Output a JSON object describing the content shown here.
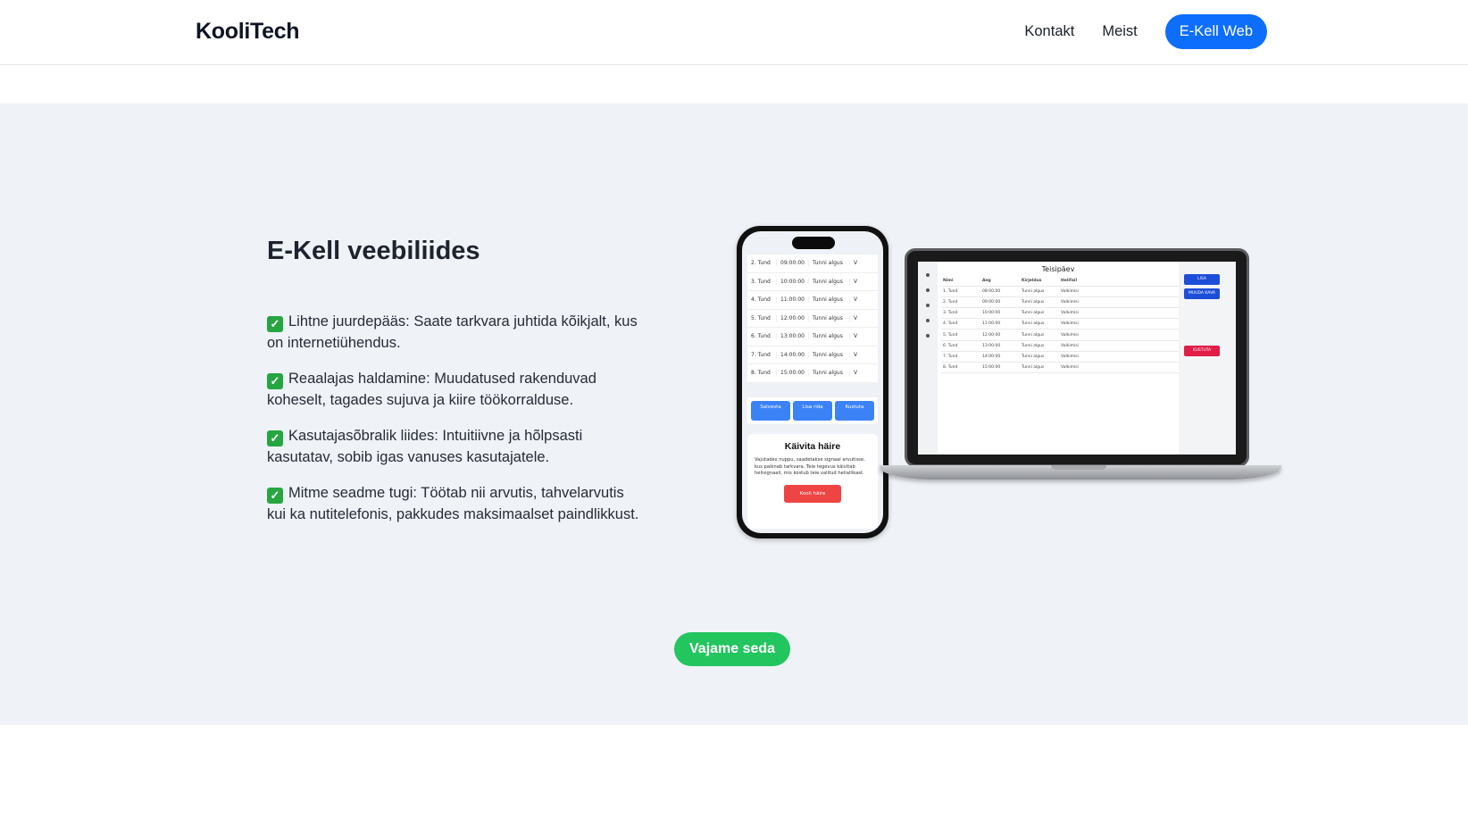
{
  "header": {
    "logo": "KooliTech",
    "nav": [
      "Kontakt",
      "Meist"
    ],
    "cta": "E-Kell Web"
  },
  "hero": {
    "title": "E-Kell veebiliides",
    "features": [
      "Lihtne juurdepääs: Saate tarkvara juhtida kõikjalt, kus on internetiühendus.",
      "Reaalajas haldamine: Muudatused rakenduvad koheselt, tagades sujuva ja kiire töökorralduse.",
      "Kasutajasõbralik liides: Intuitiivne ja hõlpsasti kasutatav, sobib igas vanuses kasutajatele.",
      "Mitme seadme tugi: Töötab nii arvutis, tahvelarvutis kui ka nutitelefonis, pakkudes maksimaalset paindlikkust."
    ],
    "check_icon": "✓",
    "button": "Vajame seda"
  },
  "phone": {
    "rows": [
      [
        "2. Tund",
        "09:00:00",
        "Tunni algus",
        "V"
      ],
      [
        "3. Tund",
        "10:00:00",
        "Tunni algus",
        "V"
      ],
      [
        "4. Tund",
        "11:00:00",
        "Tunni algus",
        "V"
      ],
      [
        "5. Tund",
        "12:00:00",
        "Tunni algus",
        "V"
      ],
      [
        "6. Tund",
        "13:00:00",
        "Tunni algus",
        "V"
      ],
      [
        "7. Tund",
        "14:00:00",
        "Tunni algus",
        "V"
      ],
      [
        "8. Tund",
        "15:00:00",
        "Tunni algus",
        "V"
      ]
    ],
    "buttons": [
      "Salvesta",
      "Lisa rida",
      "Kustuta"
    ],
    "card_title": "Käivita häire",
    "card_text": "Vajutades nuppu, saadetakse signaal arvutisse, kus paikneb tarkvara. Teie tegevus käivitab helisignaali, mis kostub teie valitud heliallikast.",
    "card_button": "Kooli häire"
  },
  "laptop": {
    "heading": "Teisipäev",
    "columns": [
      "Nimi",
      "Aeg",
      "Kirjeldus",
      "Helifail"
    ],
    "rows": [
      [
        "1. Tund",
        "08:00:00",
        "Tunni algus",
        "Valkimisi"
      ],
      [
        "2. Tund",
        "09:00:00",
        "Tunni algus",
        "Valkimisi"
      ],
      [
        "3. Tund",
        "10:00:00",
        "Tunni algus",
        "Valkimisi"
      ],
      [
        "4. Tund",
        "11:00:00",
        "Tunni algus",
        "Valkimisi"
      ],
      [
        "5. Tund",
        "12:00:00",
        "Tunni algus",
        "Valkimisi"
      ],
      [
        "6. Tund",
        "13:00:00",
        "Tunni algus",
        "Valkimisi"
      ],
      [
        "7. Tund",
        "14:00:00",
        "Tunni algus",
        "Valkimisi"
      ],
      [
        "8. Tund",
        "15:00:00",
        "Tunni algus",
        "Valkimisi"
      ]
    ],
    "buttons": [
      "LISA",
      "MUUDA KAVA",
      "KUSTUTA"
    ]
  }
}
